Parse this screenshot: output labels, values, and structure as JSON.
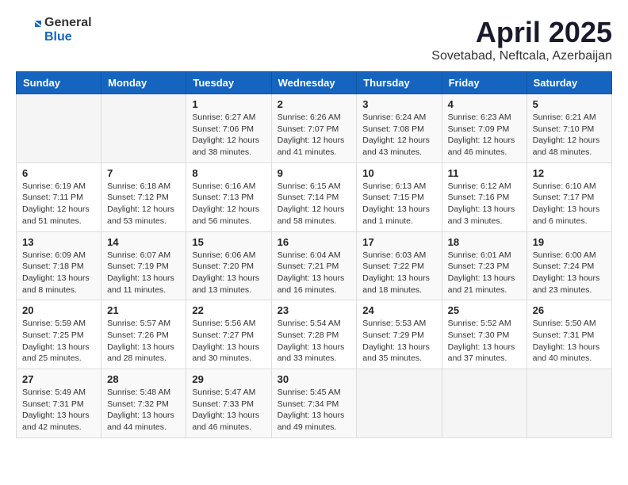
{
  "header": {
    "logo_general": "General",
    "logo_blue": "Blue",
    "month": "April 2025",
    "location": "Sovetabad, Neftcala, Azerbaijan"
  },
  "weekdays": [
    "Sunday",
    "Monday",
    "Tuesday",
    "Wednesday",
    "Thursday",
    "Friday",
    "Saturday"
  ],
  "weeks": [
    [
      {
        "day": "",
        "sunrise": "",
        "sunset": "",
        "daylight": ""
      },
      {
        "day": "",
        "sunrise": "",
        "sunset": "",
        "daylight": ""
      },
      {
        "day": "1",
        "sunrise": "Sunrise: 6:27 AM",
        "sunset": "Sunset: 7:06 PM",
        "daylight": "Daylight: 12 hours and 38 minutes."
      },
      {
        "day": "2",
        "sunrise": "Sunrise: 6:26 AM",
        "sunset": "Sunset: 7:07 PM",
        "daylight": "Daylight: 12 hours and 41 minutes."
      },
      {
        "day": "3",
        "sunrise": "Sunrise: 6:24 AM",
        "sunset": "Sunset: 7:08 PM",
        "daylight": "Daylight: 12 hours and 43 minutes."
      },
      {
        "day": "4",
        "sunrise": "Sunrise: 6:23 AM",
        "sunset": "Sunset: 7:09 PM",
        "daylight": "Daylight: 12 hours and 46 minutes."
      },
      {
        "day": "5",
        "sunrise": "Sunrise: 6:21 AM",
        "sunset": "Sunset: 7:10 PM",
        "daylight": "Daylight: 12 hours and 48 minutes."
      }
    ],
    [
      {
        "day": "6",
        "sunrise": "Sunrise: 6:19 AM",
        "sunset": "Sunset: 7:11 PM",
        "daylight": "Daylight: 12 hours and 51 minutes."
      },
      {
        "day": "7",
        "sunrise": "Sunrise: 6:18 AM",
        "sunset": "Sunset: 7:12 PM",
        "daylight": "Daylight: 12 hours and 53 minutes."
      },
      {
        "day": "8",
        "sunrise": "Sunrise: 6:16 AM",
        "sunset": "Sunset: 7:13 PM",
        "daylight": "Daylight: 12 hours and 56 minutes."
      },
      {
        "day": "9",
        "sunrise": "Sunrise: 6:15 AM",
        "sunset": "Sunset: 7:14 PM",
        "daylight": "Daylight: 12 hours and 58 minutes."
      },
      {
        "day": "10",
        "sunrise": "Sunrise: 6:13 AM",
        "sunset": "Sunset: 7:15 PM",
        "daylight": "Daylight: 13 hours and 1 minute."
      },
      {
        "day": "11",
        "sunrise": "Sunrise: 6:12 AM",
        "sunset": "Sunset: 7:16 PM",
        "daylight": "Daylight: 13 hours and 3 minutes."
      },
      {
        "day": "12",
        "sunrise": "Sunrise: 6:10 AM",
        "sunset": "Sunset: 7:17 PM",
        "daylight": "Daylight: 13 hours and 6 minutes."
      }
    ],
    [
      {
        "day": "13",
        "sunrise": "Sunrise: 6:09 AM",
        "sunset": "Sunset: 7:18 PM",
        "daylight": "Daylight: 13 hours and 8 minutes."
      },
      {
        "day": "14",
        "sunrise": "Sunrise: 6:07 AM",
        "sunset": "Sunset: 7:19 PM",
        "daylight": "Daylight: 13 hours and 11 minutes."
      },
      {
        "day": "15",
        "sunrise": "Sunrise: 6:06 AM",
        "sunset": "Sunset: 7:20 PM",
        "daylight": "Daylight: 13 hours and 13 minutes."
      },
      {
        "day": "16",
        "sunrise": "Sunrise: 6:04 AM",
        "sunset": "Sunset: 7:21 PM",
        "daylight": "Daylight: 13 hours and 16 minutes."
      },
      {
        "day": "17",
        "sunrise": "Sunrise: 6:03 AM",
        "sunset": "Sunset: 7:22 PM",
        "daylight": "Daylight: 13 hours and 18 minutes."
      },
      {
        "day": "18",
        "sunrise": "Sunrise: 6:01 AM",
        "sunset": "Sunset: 7:23 PM",
        "daylight": "Daylight: 13 hours and 21 minutes."
      },
      {
        "day": "19",
        "sunrise": "Sunrise: 6:00 AM",
        "sunset": "Sunset: 7:24 PM",
        "daylight": "Daylight: 13 hours and 23 minutes."
      }
    ],
    [
      {
        "day": "20",
        "sunrise": "Sunrise: 5:59 AM",
        "sunset": "Sunset: 7:25 PM",
        "daylight": "Daylight: 13 hours and 25 minutes."
      },
      {
        "day": "21",
        "sunrise": "Sunrise: 5:57 AM",
        "sunset": "Sunset: 7:26 PM",
        "daylight": "Daylight: 13 hours and 28 minutes."
      },
      {
        "day": "22",
        "sunrise": "Sunrise: 5:56 AM",
        "sunset": "Sunset: 7:27 PM",
        "daylight": "Daylight: 13 hours and 30 minutes."
      },
      {
        "day": "23",
        "sunrise": "Sunrise: 5:54 AM",
        "sunset": "Sunset: 7:28 PM",
        "daylight": "Daylight: 13 hours and 33 minutes."
      },
      {
        "day": "24",
        "sunrise": "Sunrise: 5:53 AM",
        "sunset": "Sunset: 7:29 PM",
        "daylight": "Daylight: 13 hours and 35 minutes."
      },
      {
        "day": "25",
        "sunrise": "Sunrise: 5:52 AM",
        "sunset": "Sunset: 7:30 PM",
        "daylight": "Daylight: 13 hours and 37 minutes."
      },
      {
        "day": "26",
        "sunrise": "Sunrise: 5:50 AM",
        "sunset": "Sunset: 7:31 PM",
        "daylight": "Daylight: 13 hours and 40 minutes."
      }
    ],
    [
      {
        "day": "27",
        "sunrise": "Sunrise: 5:49 AM",
        "sunset": "Sunset: 7:31 PM",
        "daylight": "Daylight: 13 hours and 42 minutes."
      },
      {
        "day": "28",
        "sunrise": "Sunrise: 5:48 AM",
        "sunset": "Sunset: 7:32 PM",
        "daylight": "Daylight: 13 hours and 44 minutes."
      },
      {
        "day": "29",
        "sunrise": "Sunrise: 5:47 AM",
        "sunset": "Sunset: 7:33 PM",
        "daylight": "Daylight: 13 hours and 46 minutes."
      },
      {
        "day": "30",
        "sunrise": "Sunrise: 5:45 AM",
        "sunset": "Sunset: 7:34 PM",
        "daylight": "Daylight: 13 hours and 49 minutes."
      },
      {
        "day": "",
        "sunrise": "",
        "sunset": "",
        "daylight": ""
      },
      {
        "day": "",
        "sunrise": "",
        "sunset": "",
        "daylight": ""
      },
      {
        "day": "",
        "sunrise": "",
        "sunset": "",
        "daylight": ""
      }
    ]
  ]
}
